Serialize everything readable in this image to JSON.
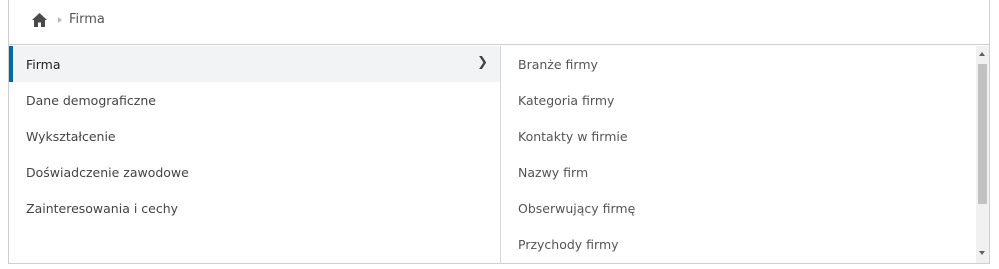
{
  "breadcrumb": {
    "home_icon": "home-icon",
    "current": "Firma"
  },
  "left_menu": {
    "items": [
      {
        "label": "Firma",
        "active": true
      },
      {
        "label": "Dane demograficzne",
        "active": false
      },
      {
        "label": "Wykształcenie",
        "active": false
      },
      {
        "label": "Doświadczenie zawodowe",
        "active": false
      },
      {
        "label": "Zainteresowania i cechy",
        "active": false
      }
    ],
    "active_chevron": "❯",
    "accent_color": "#0a66a8"
  },
  "right_menu": {
    "items": [
      {
        "label": "Branże firmy"
      },
      {
        "label": "Kategoria firmy"
      },
      {
        "label": "Kontakty w firmie"
      },
      {
        "label": "Nazwy firm"
      },
      {
        "label": "Obserwujący firmę"
      },
      {
        "label": "Przychody firmy"
      }
    ]
  }
}
